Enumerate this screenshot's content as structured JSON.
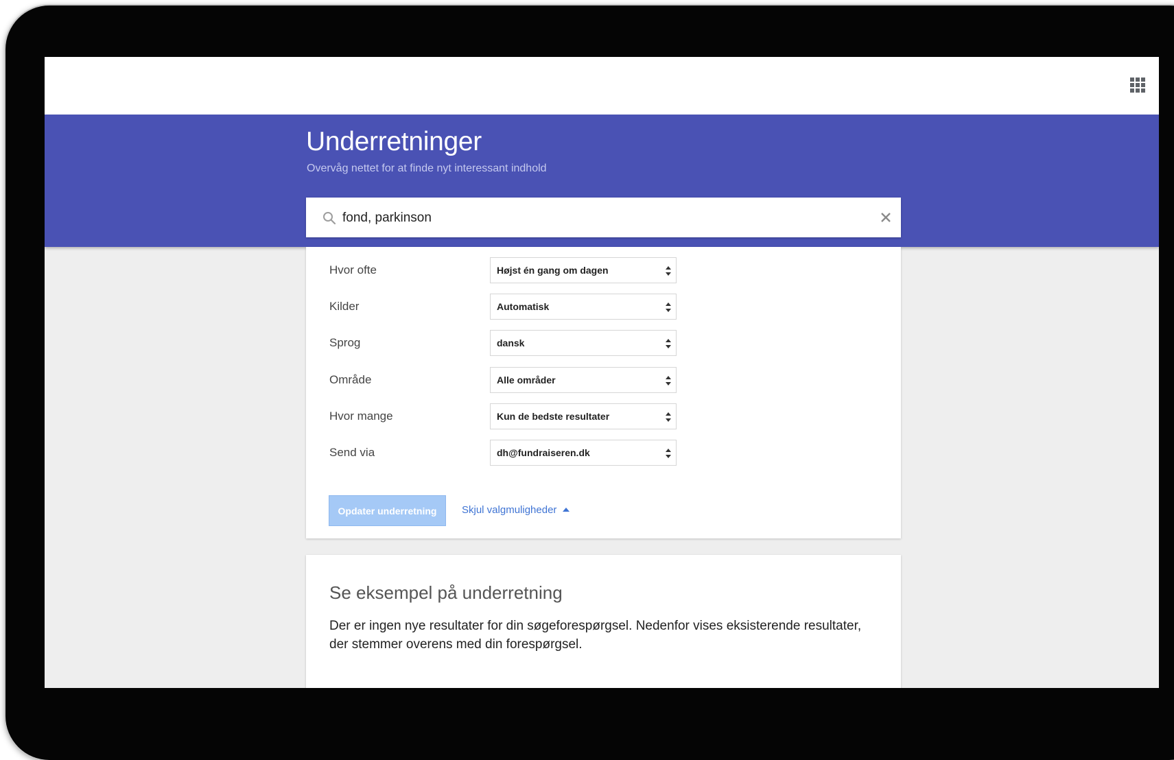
{
  "header": {
    "title": "Underretninger",
    "subtitle": "Overvåg nettet for at finde nyt interessant indhold",
    "background_color": "#4a52b4"
  },
  "search": {
    "value": "fond, parkinson",
    "icon": "search-icon",
    "clear_icon": "close-icon"
  },
  "options": [
    {
      "label": "Hvor ofte",
      "value": "Højst én gang om dagen"
    },
    {
      "label": "Kilder",
      "value": "Automatisk"
    },
    {
      "label": "Sprog",
      "value": "dansk"
    },
    {
      "label": "Område",
      "value": "Alle områder"
    },
    {
      "label": "Hvor mange",
      "value": "Kun de bedste resultater"
    },
    {
      "label": "Send via",
      "value": "dh@fundraiseren.dk"
    }
  ],
  "actions": {
    "update_label": "Opdater underretning",
    "hide_options_label": "Skjul valgmuligheder",
    "link_color": "#3f74d4"
  },
  "example": {
    "title": "Se eksempel på underretning",
    "text": "Der er ingen nye resultater for din søgeforespørgsel. Nedenfor vises eksisterende resultater, der stemmer overens med din forespørgsel."
  }
}
